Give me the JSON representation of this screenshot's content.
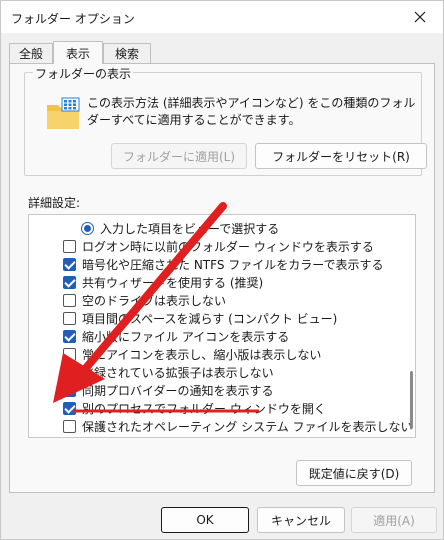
{
  "window": {
    "title": "フォルダー オプション"
  },
  "tabs": [
    {
      "label": "全般",
      "active": false
    },
    {
      "label": "表示",
      "active": true
    },
    {
      "label": "検索",
      "active": false
    }
  ],
  "folder_views": {
    "group_title": "フォルダーの表示",
    "description": "この表示方法 (詳細表示やアイコンなど) をこの種類のフォルダーすべてに適用することができます。",
    "apply_button": "フォルダーに適用(L)",
    "reset_button": "フォルダーをリセット(R)"
  },
  "advanced": {
    "label": "詳細設定:",
    "items": [
      {
        "type": "radio",
        "checked": true,
        "label": "入力した項目をビューで選択する"
      },
      {
        "type": "checkbox",
        "checked": false,
        "label": "ログオン時に以前のフォルダー ウィンドウを表示する"
      },
      {
        "type": "checkbox",
        "checked": true,
        "label": "暗号化や圧縮された NTFS ファイルをカラーで表示する"
      },
      {
        "type": "checkbox",
        "checked": true,
        "label": "共有ウィザードを使用する (推奨)"
      },
      {
        "type": "checkbox",
        "checked": false,
        "label": "空のドライブは表示しない"
      },
      {
        "type": "checkbox",
        "checked": false,
        "label": "項目間のスペースを減らす (コンパクト ビュー)"
      },
      {
        "type": "checkbox",
        "checked": true,
        "label": "縮小版にファイル アイコンを表示する"
      },
      {
        "type": "checkbox",
        "checked": false,
        "label": "常にアイコンを表示し、縮小版は表示しない"
      },
      {
        "type": "checkbox",
        "checked": false,
        "label": "登録されている拡張子は表示しない"
      },
      {
        "type": "checkbox",
        "checked": true,
        "label": "同期プロバイダーの通知を表示する"
      },
      {
        "type": "checkbox",
        "checked": true,
        "label": "別のプロセスでフォルダー ウィンドウを開く"
      },
      {
        "type": "checkbox",
        "checked": false,
        "label": "保護されたオペレーティング システム ファイルを表示しない (推奨)"
      }
    ],
    "restore_button": "既定値に戻す(D)"
  },
  "footer": {
    "ok": "OK",
    "cancel": "キャンセル",
    "apply": "適用(A)"
  },
  "colors": {
    "annotation": "#e02020",
    "accent": "#1f5fb8"
  },
  "icons": {
    "close": "close-icon",
    "folder": "folder-icon"
  }
}
